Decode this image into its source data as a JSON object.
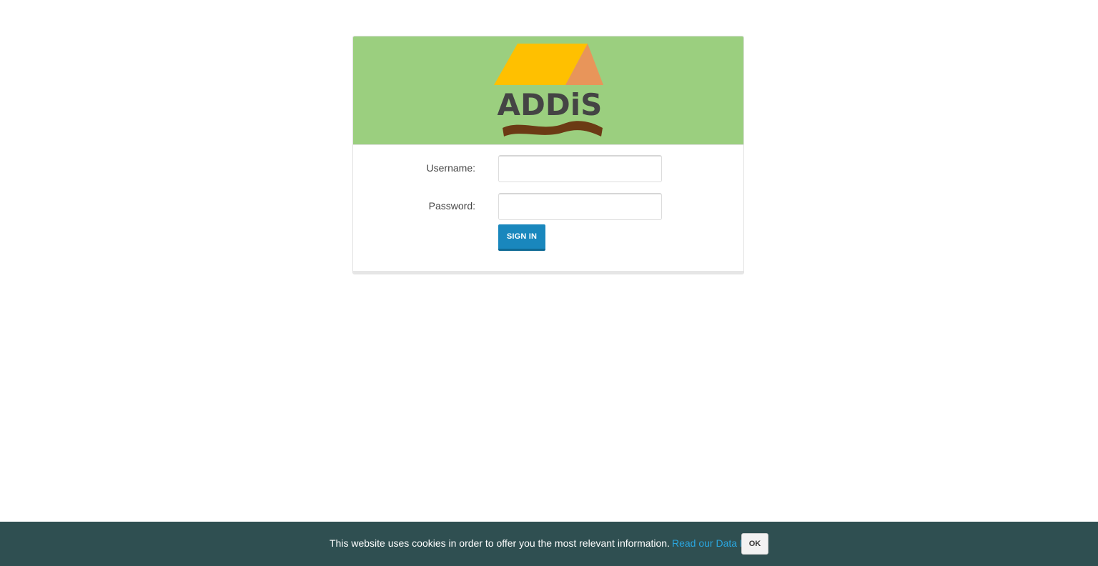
{
  "logo": {
    "name": "ADDiS",
    "colors": {
      "banner": "#9bcf7f",
      "roof_front": "#ffc000",
      "roof_side": "#e8955a",
      "text": "#444444",
      "ground": "#6b3a14"
    }
  },
  "login": {
    "username_label": "Username:",
    "username_value": "",
    "password_label": "Password:",
    "password_value": "",
    "signin_label": "SIGN IN",
    "accent": "#1987bd"
  },
  "cookie_bar": {
    "message": "This website uses cookies in order to offer you the most relevant information.",
    "link_label": "Read our Data Policy.",
    "ok_label": "OK",
    "background": "#2f4f51",
    "link_color": "#2aa6df"
  }
}
